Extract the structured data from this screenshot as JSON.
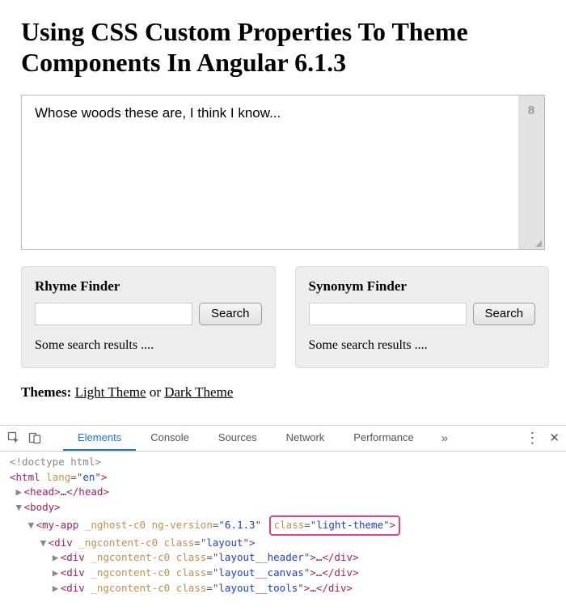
{
  "header": {
    "title": "Using CSS Custom Properties To Theme Components In Angular 6.1.3"
  },
  "editor": {
    "value": "Whose woods these are, I think I know...",
    "wordCount": "8"
  },
  "finders": [
    {
      "title": "Rhyme Finder",
      "button": "Search",
      "results": "Some search results ...."
    },
    {
      "title": "Synonym Finder",
      "button": "Search",
      "results": "Some search results ...."
    }
  ],
  "themes": {
    "label": "Themes:",
    "light": "Light Theme",
    "or": " or ",
    "dark": "Dark Theme"
  },
  "devtools": {
    "tabs": [
      "Elements",
      "Console",
      "Sources",
      "Network",
      "Performance"
    ],
    "activeTab": "Elements",
    "code": {
      "doctype": "<!doctype html>",
      "htmlOpen": "html",
      "htmlLangAttr": "lang",
      "htmlLangVal": "en",
      "head": "head",
      "body": "body",
      "myApp": "my-app",
      "nghost": "_nghost-c0",
      "ngversionAttr": "ng-version",
      "ngversionVal": "6.1.3",
      "classAttr": "class",
      "lightThemeVal": "light-theme",
      "div": "div",
      "ngcontent": "_ngcontent-c0",
      "layoutVal": "layout",
      "layoutHeaderVal": "layout__header",
      "layoutCanvasVal": "layout__canvas",
      "layoutToolsVal": "layout__tools"
    }
  }
}
